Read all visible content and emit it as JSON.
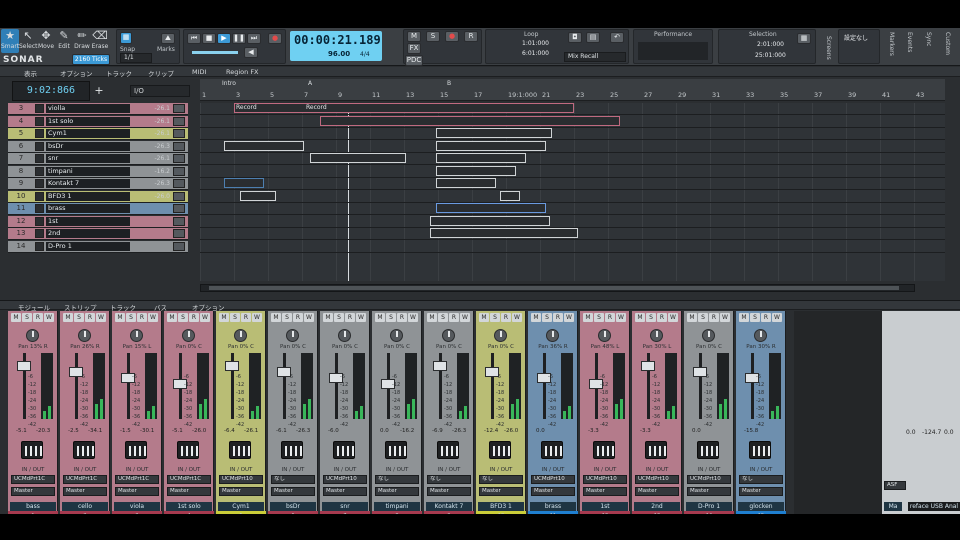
{
  "colors": {
    "accent": "#3c9ad6",
    "timecode_bg": "#6fd0f2",
    "pink": "#b47b8b",
    "yellow": "#b9bd75",
    "blue": "#6e8fae",
    "gray": "#8f9396",
    "green_meter": "#39b65a"
  },
  "control_bar": {
    "tools": [
      {
        "icon": "smart-tool-icon",
        "label": "Smart"
      },
      {
        "icon": "select-tool-icon",
        "label": "Select"
      },
      {
        "icon": "move-tool-icon",
        "label": "Move"
      },
      {
        "icon": "edit-tool-icon",
        "label": "Edit"
      },
      {
        "icon": "draw-tool-icon",
        "label": "Draw"
      },
      {
        "icon": "erase-tool-icon",
        "label": "Erase"
      }
    ],
    "brand": "SONAR",
    "snap_label": "Snap",
    "snap_value": "1/1",
    "marks_label": "Marks",
    "ticks": "2160 Ticks",
    "timecode": "00:00:21.189",
    "tempo": "96.00",
    "meter": "4/4",
    "mix_buttons": [
      "M",
      "S",
      "FX",
      "PDC"
    ],
    "loop_label": "Loop",
    "loop_start": "1:01:000",
    "loop_end": "6:01:000",
    "mix_recall": "Mix Recall",
    "performance_label": "Performance",
    "selection_label": "Selection",
    "selection_start": "2:01:000",
    "selection_end": "25:01:000",
    "screenset_label": "Screens",
    "setting_none": "設定なし",
    "right_labels": [
      "Markers",
      "Events",
      "Sync",
      "Custom"
    ]
  },
  "track_menu": [
    "表示",
    "オプション",
    "トラック",
    "クリップ",
    "MIDI",
    "Region FX"
  ],
  "now_time": "9:02:866",
  "io_select": "I/O",
  "ruler": {
    "markers": [
      {
        "label": "Intro",
        "bar": "1"
      },
      {
        "label": "A",
        "bar": "7"
      },
      {
        "label": "B",
        "bar": "15"
      }
    ],
    "ticks": [
      "1",
      "3",
      "5",
      "7",
      "9",
      "11",
      "13",
      "15",
      "17",
      "19:1:000",
      "21",
      "23",
      "25",
      "27",
      "29",
      "31",
      "33",
      "35",
      "37",
      "39",
      "41",
      "43"
    ]
  },
  "tracks": [
    {
      "num": "3",
      "name": "violla",
      "vol": "-26.1",
      "color": "pink"
    },
    {
      "num": "4",
      "name": "1st solo",
      "vol": "-26.1",
      "color": "pink"
    },
    {
      "num": "5",
      "name": "Cym1",
      "vol": "-26.1",
      "color": "yellow"
    },
    {
      "num": "6",
      "name": "bsDr",
      "vol": "-26.3",
      "color": "gray"
    },
    {
      "num": "7",
      "name": "snr",
      "vol": "-26.1",
      "color": "gray"
    },
    {
      "num": "8",
      "name": "timpani",
      "vol": "-16.2",
      "color": "gray"
    },
    {
      "num": "9",
      "name": "Kontakt 7",
      "vol": "-26.3",
      "color": "gray"
    },
    {
      "num": "10",
      "name": "BFD3 1",
      "vol": "-26.0",
      "color": "yellow"
    },
    {
      "num": "11",
      "name": "brass",
      "vol": "",
      "color": "blue"
    },
    {
      "num": "12",
      "name": "1st",
      "vol": "",
      "color": "pink"
    },
    {
      "num": "13",
      "name": "2nd",
      "vol": "",
      "color": "pink"
    },
    {
      "num": "14",
      "name": "D-Pro 1",
      "vol": "",
      "color": "gray"
    }
  ],
  "clip_text": [
    "Record",
    "Record"
  ],
  "console_menu": [
    "モジュール",
    "ストリップ",
    "トラック",
    "バス",
    "オプション"
  ],
  "strips": [
    {
      "name": "bass",
      "num": "1",
      "pan": "Pan 13% R",
      "v1": "-5.1",
      "v2": "-20.3",
      "color": "pink",
      "stripe": "#a63a4f",
      "inst": "UCMdPrt1C",
      "out": "Master"
    },
    {
      "name": "cello",
      "num": "2",
      "pan": "Pan 26% R",
      "v1": "-2.5",
      "v2": "-34.1",
      "color": "pink",
      "stripe": "#a63a4f",
      "inst": "UCMdPrt1C",
      "out": "Master"
    },
    {
      "name": "viola",
      "num": "3",
      "pan": "Pan 15% L",
      "v1": "-1.5",
      "v2": "-30.1",
      "color": "pink",
      "stripe": "#a63a4f",
      "inst": "UCMdPrt1C",
      "out": "Master"
    },
    {
      "name": "1st solo",
      "num": "4",
      "pan": "Pan 0% C",
      "v1": "-5.1",
      "v2": "-26.0",
      "color": "pink",
      "stripe": "#a63a4f",
      "inst": "UCMdPrt1C",
      "out": "Master"
    },
    {
      "name": "Cym1",
      "num": "5",
      "pan": "Pan 0% C",
      "v1": "-6.4",
      "v2": "-26.1",
      "color": "yellow",
      "stripe": "#c9cc39",
      "inst": "UCMdPrt10",
      "out": "Master"
    },
    {
      "name": "bsDr",
      "num": "6",
      "pan": "Pan 0% C",
      "v1": "-6.1",
      "v2": "-26.3",
      "color": "gray",
      "stripe": "#a63a4f",
      "inst": "なし",
      "out": "Master"
    },
    {
      "name": "snr",
      "num": "7",
      "pan": "Pan 0% C",
      "v1": "-6.0",
      "v2": "",
      "color": "gray",
      "stripe": "#a63a4f",
      "inst": "UCMdPrt10",
      "out": "Master"
    },
    {
      "name": "timpani",
      "num": "8",
      "pan": "Pan 0% C",
      "v1": "0.0",
      "v2": "-16.2",
      "color": "gray",
      "stripe": "#a63a4f",
      "inst": "なし",
      "out": "Master"
    },
    {
      "name": "Kontakt 7",
      "num": "9",
      "pan": "Pan 0% C",
      "v1": "-6.9",
      "v2": "-26.3",
      "color": "gray",
      "stripe": "#a63a4f",
      "inst": "なし",
      "out": "Master"
    },
    {
      "name": "BFD3 1",
      "num": "10",
      "pan": "Pan 0% C",
      "v1": "-12.4",
      "v2": "-26.0",
      "color": "yellow",
      "stripe": "#c9cc39",
      "inst": "なし",
      "out": "Master"
    },
    {
      "name": "brass",
      "num": "11",
      "pan": "Pan 36% R",
      "v1": "0.0",
      "v2": "",
      "color": "blue",
      "stripe": "#1f7fd0",
      "inst": "UCMdPrt10",
      "out": "Master"
    },
    {
      "name": "1st",
      "num": "12",
      "pan": "Pan 48% L",
      "v1": "-3.3",
      "v2": "",
      "color": "pink",
      "stripe": "#a63a4f",
      "inst": "UCMdPrt10",
      "out": "Master"
    },
    {
      "name": "2nd",
      "num": "13",
      "pan": "Pan 30% L",
      "v1": "-3.3",
      "v2": "",
      "color": "pink",
      "stripe": "#a63a4f",
      "inst": "UCMdPrt10",
      "out": "Master"
    },
    {
      "name": "D-Pro 1",
      "num": "14",
      "pan": "Pan 0% C",
      "v1": "0.0",
      "v2": "",
      "color": "gray",
      "stripe": "#a63a4f",
      "inst": "UCMdPrt10",
      "out": "Master"
    },
    {
      "name": "glocken",
      "num": "15",
      "pan": "Pan 30% R",
      "v1": "-15.8",
      "v2": "",
      "color": "blue",
      "stripe": "#1f7fd0",
      "inst": "なし",
      "out": "Master"
    }
  ],
  "strip_io_label": "IN / OUT",
  "scale": [
    "-6",
    "-12",
    "-18",
    "-24",
    "-30",
    "-36",
    "-42"
  ],
  "master": {
    "v1": "0.0",
    "v2": "-124.7",
    "v3": "0.0",
    "in": "ASF",
    "out_label": "Ma",
    "device": "reface USB Anal"
  }
}
